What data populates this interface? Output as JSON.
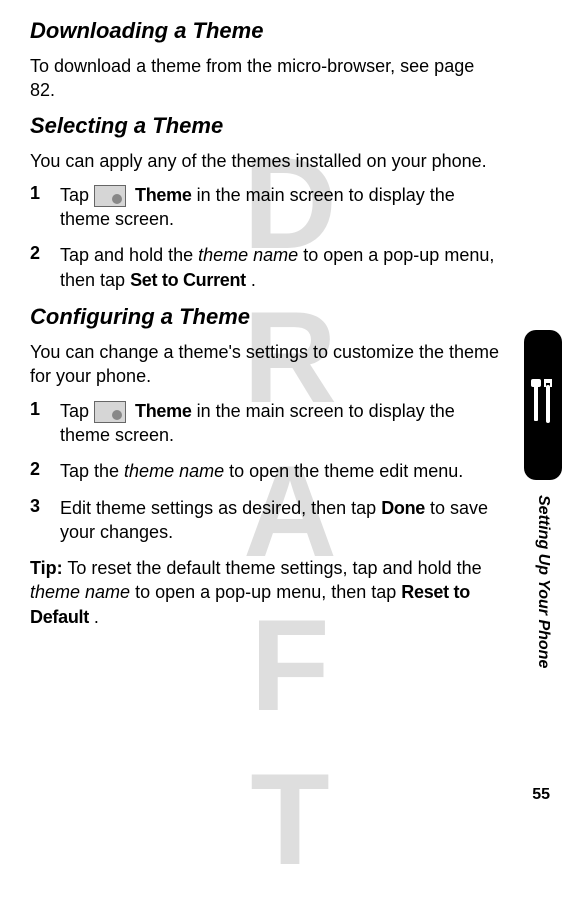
{
  "watermark": "DRAFT",
  "sections": {
    "downloading": {
      "heading": "Downloading a Theme",
      "body": "To download a theme from the micro-browser, see page 82."
    },
    "selecting": {
      "heading": "Selecting a Theme",
      "body": "You can apply any of the themes installed on your phone.",
      "step1_a": "Tap ",
      "step1_theme": "Theme",
      "step1_b": " in the main screen to display the theme screen.",
      "step2_a": "Tap and hold the ",
      "step2_italic": "theme name",
      "step2_b": " to open a pop-up menu, then tap ",
      "step2_ui": "Set to Current",
      "step2_c": "."
    },
    "configuring": {
      "heading": "Configuring a Theme",
      "body": "You can change a theme's settings to customize the theme for your phone.",
      "step1_a": "Tap ",
      "step1_theme": "Theme",
      "step1_b": " in the main screen to display the theme screen.",
      "step2_a": "Tap the ",
      "step2_italic": "theme name",
      "step2_b": " to open the theme edit menu.",
      "step3_a": "Edit theme settings as desired, then tap ",
      "step3_ui": "Done",
      "step3_b": " to save your changes.",
      "tip_label": "Tip:",
      "tip_a": " To reset the default theme settings, tap and hold the ",
      "tip_italic": "theme name",
      "tip_b": " to open a pop-up menu, then tap ",
      "tip_ui": "Reset to Default",
      "tip_c": "."
    }
  },
  "steps_num": {
    "n1": "1",
    "n2": "2",
    "n3": "3"
  },
  "side_label": "Setting Up Your Phone",
  "page_number": "55"
}
